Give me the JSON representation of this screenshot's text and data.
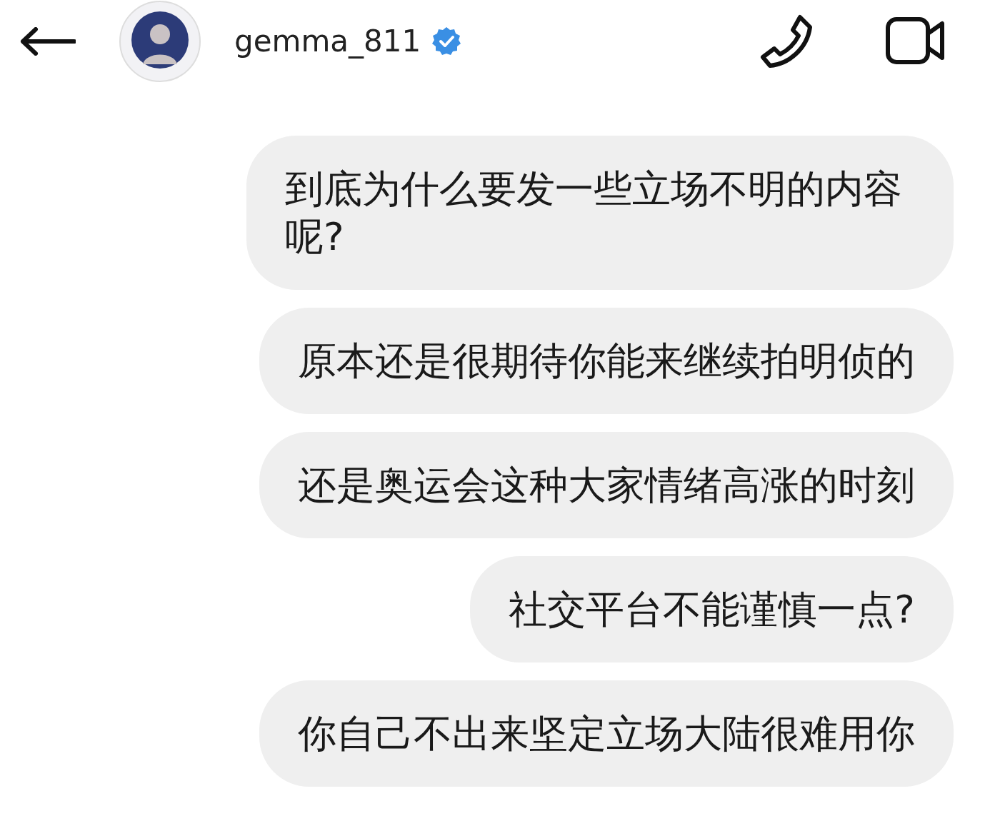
{
  "header": {
    "username": "gemma_811",
    "verified": true
  },
  "messages": [
    {
      "text": "到底为什么要发一些立场不明的内容呢?"
    },
    {
      "text": "原本还是很期待你能来继续拍明侦的"
    },
    {
      "text": "还是奥运会这种大家情绪高涨的时刻"
    },
    {
      "text": "社交平台不能谨慎一点?"
    },
    {
      "text": "你自己不出来坚定立场大陆很难用你"
    }
  ]
}
